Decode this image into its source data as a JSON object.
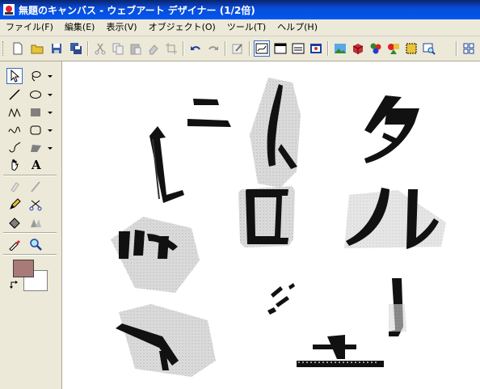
{
  "window": {
    "title": "無題のキャンバス - ウェブアート デザイナー (1/2倍)"
  },
  "menu": [
    {
      "label": "ファイル(F)"
    },
    {
      "label": "編集(E)"
    },
    {
      "label": "表示(V)"
    },
    {
      "label": "オブジェクト(O)"
    },
    {
      "label": "ツール(T)"
    },
    {
      "label": "ヘルプ(H)"
    }
  ],
  "canvas": {
    "characters": [
      "ニ",
      "ト",
      "タ",
      "ル",
      "ロ",
      "ミ",
      "ジ",
      "ム",
      "エ",
      "J"
    ]
  },
  "colors": {
    "foreground": "#a87a78",
    "background": "#ffffff",
    "titlebar": "#0a4bd8"
  }
}
